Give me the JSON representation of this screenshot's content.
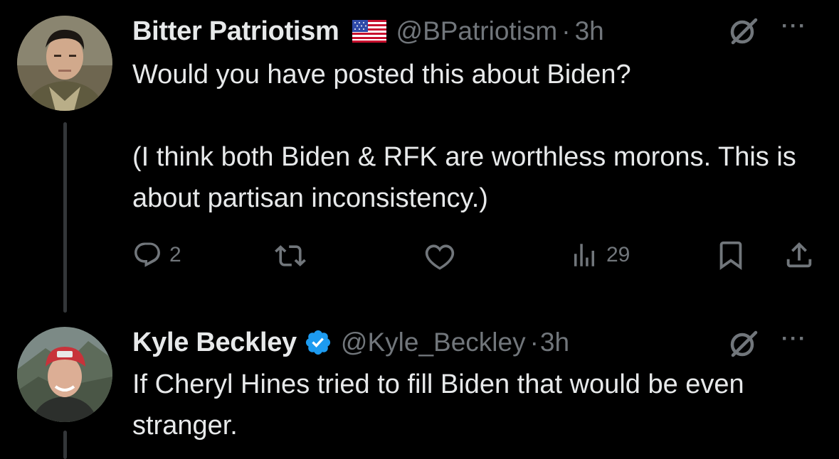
{
  "tweets": [
    {
      "name": "Bitter Patriotism",
      "flag": "us-flag-emoji",
      "handle": "@BPatriotism",
      "separator": "·",
      "time": "3h",
      "text": "Would you have posted this about Biden?\n\n(I think both Biden & RFK are worthless morons. This is about partisan inconsistency.)",
      "replies": "2",
      "views": "29"
    },
    {
      "name": "Kyle Beckley",
      "verified": true,
      "handle": "@Kyle_Beckley",
      "separator": "·",
      "time": "3h",
      "text": "If Cheryl Hines tried to fill Biden that would be even stranger."
    }
  ],
  "ui": {
    "more_label": "···"
  },
  "colors": {
    "background": "#000000",
    "text": "#e7e9ea",
    "muted": "#71767b",
    "verified": "#1d9bf0",
    "thread_line": "#333639"
  }
}
